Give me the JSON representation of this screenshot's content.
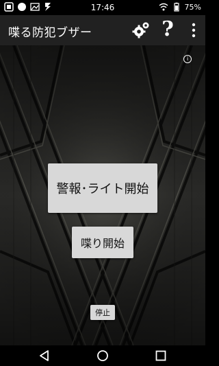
{
  "status_bar": {
    "time": "17:46",
    "battery": "75%",
    "left_icons": [
      "app-icon",
      "circle-icon",
      "image-icon",
      "bolt-icon"
    ],
    "right_icons": [
      "wifi-icon",
      "battery-icon"
    ]
  },
  "app_bar": {
    "title": "喋る防犯ブザー",
    "actions": [
      "gear-icon",
      "help-icon",
      "overflow-menu-icon"
    ],
    "help_label": "?"
  },
  "main": {
    "info_label": "i",
    "alarm_button": "警報･ライト開始",
    "speak_button": "喋り開始",
    "stop_button": "停止"
  },
  "nav_bar": {
    "items": [
      "back-icon",
      "home-icon",
      "recents-icon"
    ]
  },
  "colors": {
    "app_bar_bg": "#212121",
    "button_bg": "#d8d8d8",
    "background_pattern": "#2a2a28"
  }
}
